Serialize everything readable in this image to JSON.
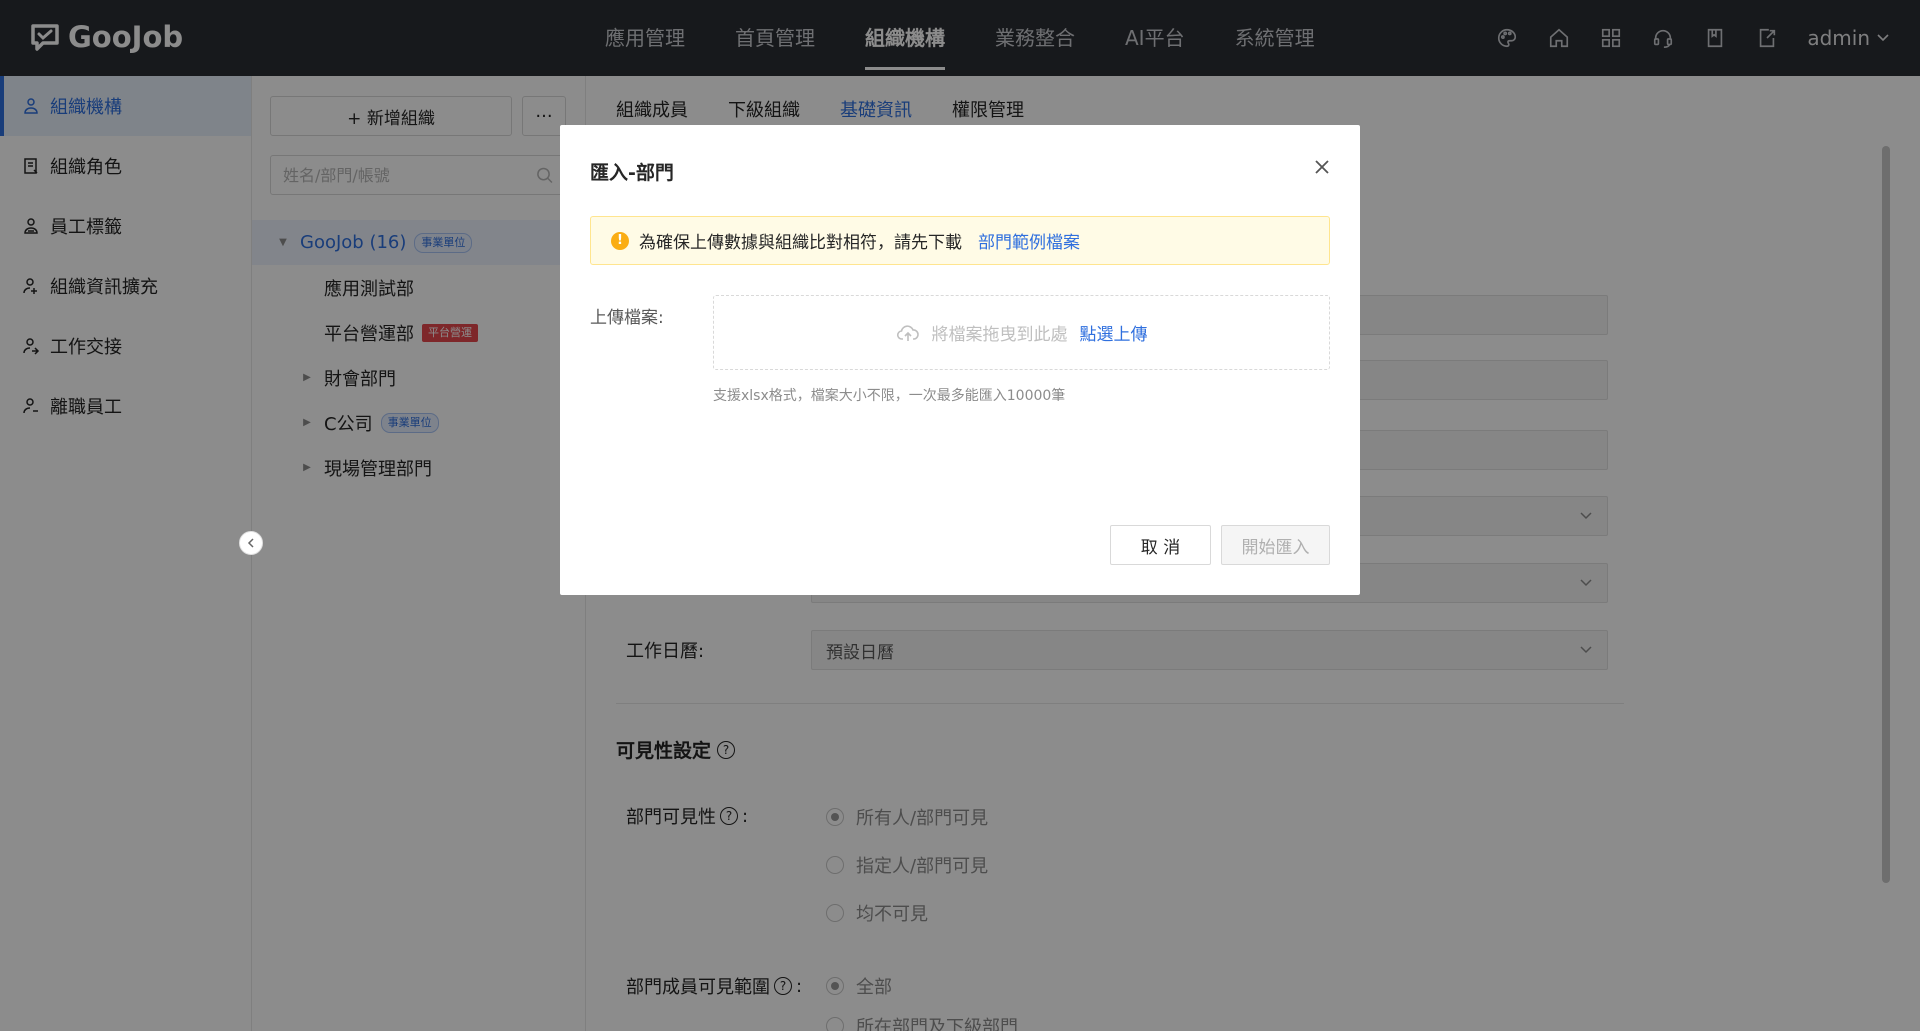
{
  "topbar": {
    "logo_text": "GooJob",
    "nav": [
      {
        "label": "應用管理",
        "active": false
      },
      {
        "label": "首頁管理",
        "active": false
      },
      {
        "label": "組織機構",
        "active": true
      },
      {
        "label": "業務整合",
        "active": false
      },
      {
        "label": "AI平台",
        "active": false
      },
      {
        "label": "系統管理",
        "active": false
      }
    ],
    "icons": [
      "palette-icon",
      "home-icon",
      "apps-grid-icon",
      "headset-icon",
      "book-icon",
      "export-icon"
    ],
    "user": "admin"
  },
  "sidebar": {
    "items": [
      {
        "label": "組織機構",
        "icon": "org-icon",
        "active": true
      },
      {
        "label": "組織角色",
        "icon": "role-icon",
        "active": false
      },
      {
        "label": "員工標籤",
        "icon": "tag-icon",
        "active": false
      },
      {
        "label": "組織資訊擴充",
        "icon": "user-plus-icon",
        "active": false
      },
      {
        "label": "工作交接",
        "icon": "handover-icon",
        "active": false
      },
      {
        "label": "離職員工",
        "icon": "user-leave-icon",
        "active": false
      }
    ]
  },
  "tree_panel": {
    "add_label": "+ 新增組織",
    "more_label": "···",
    "search_placeholder": "姓名/部門/帳號",
    "root": {
      "label": "GooJob (16)",
      "badge": "事業單位"
    },
    "children": [
      {
        "label": "應用測試部",
        "badge": "",
        "expandable": false
      },
      {
        "label": "平台營運部",
        "badge": "平台營運",
        "expandable": false
      },
      {
        "label": "財會部門",
        "badge": "",
        "expandable": true
      },
      {
        "label": "C公司",
        "badge": "事業單位",
        "expandable": true
      },
      {
        "label": "現場管理部門",
        "badge": "",
        "expandable": true
      }
    ]
  },
  "main": {
    "tabs": [
      {
        "label": "組織成員",
        "active": false
      },
      {
        "label": "下級組織",
        "active": false
      },
      {
        "label": "基礎資訊",
        "active": true
      },
      {
        "label": "權限管理",
        "active": false
      }
    ],
    "work_calendar_label": "工作日曆:",
    "work_calendar_value": "預設日曆",
    "visibility_title": "可見性設定",
    "dept_visibility_label": "部門可見性",
    "dept_visibility_options": [
      "所有人/部門可見",
      "指定人/部門可見",
      "均不可見"
    ],
    "member_scope_label": "部門成員可見範圍",
    "member_scope_options": [
      "全部",
      "所在部門及下級部門"
    ]
  },
  "modal": {
    "title": "匯入-部門",
    "alert_text": "為確保上傳數據與組織比對相符，請先下載",
    "alert_link": "部門範例檔案",
    "upload_label": "上傳檔案:",
    "drop_hint": "將檔案拖曳到此處",
    "drop_link": "點選上傳",
    "upload_note": "支援xlsx格式，檔案大小不限，一次最多能匯入10000筆",
    "cancel_label": "取 消",
    "start_label": "開始匯入"
  },
  "colors": {
    "topbar_bg": "#2b2e33",
    "accent": "#2f6fde",
    "alert_bg": "#fffbe6",
    "alert_icon": "#faad14",
    "badge_red": "#e5484d"
  }
}
